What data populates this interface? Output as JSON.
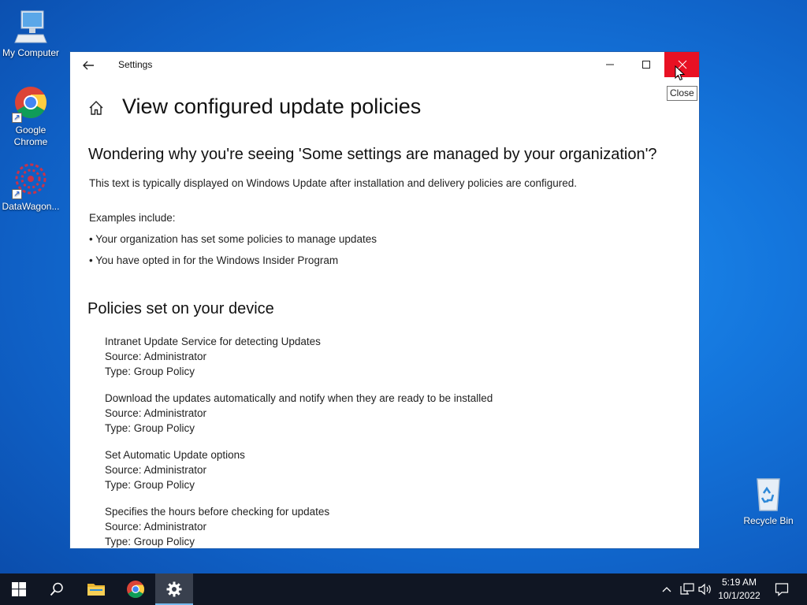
{
  "desktop": {
    "icons": [
      {
        "label": "My Computer"
      },
      {
        "label": "Google Chrome"
      },
      {
        "label": "DataWagon..."
      },
      {
        "label": "Recycle Bin"
      }
    ]
  },
  "window": {
    "title": "Settings",
    "page_title": "View configured update policies",
    "heading": "Wondering why you're seeing 'Some settings are managed by your organization'?",
    "description": "This text is typically displayed on Windows Update after installation and delivery policies are configured.",
    "examples_label": "Examples include:",
    "examples": [
      "• Your organization has set some policies to manage updates",
      "• You have opted in for the Windows Insider Program"
    ],
    "policies_heading": "Policies set on your device",
    "policies": [
      {
        "name": "Intranet Update Service for detecting Updates",
        "source": "Source: Administrator",
        "type": "Type: Group Policy"
      },
      {
        "name": "Download the updates automatically and notify when they are ready to be installed",
        "source": "Source: Administrator",
        "type": "Type: Group Policy"
      },
      {
        "name": "Set Automatic Update options",
        "source": "Source: Administrator",
        "type": "Type: Group Policy"
      },
      {
        "name": "Specifies the hours before checking for updates",
        "source": "Source: Administrator",
        "type": "Type: Group Policy"
      }
    ],
    "close_tooltip": "Close"
  },
  "taskbar": {
    "time": "5:19 AM",
    "date": "10/1/2022"
  },
  "colors": {
    "close_button": "#e81123",
    "taskbar": "#101623",
    "desktop": "#1476dd"
  }
}
